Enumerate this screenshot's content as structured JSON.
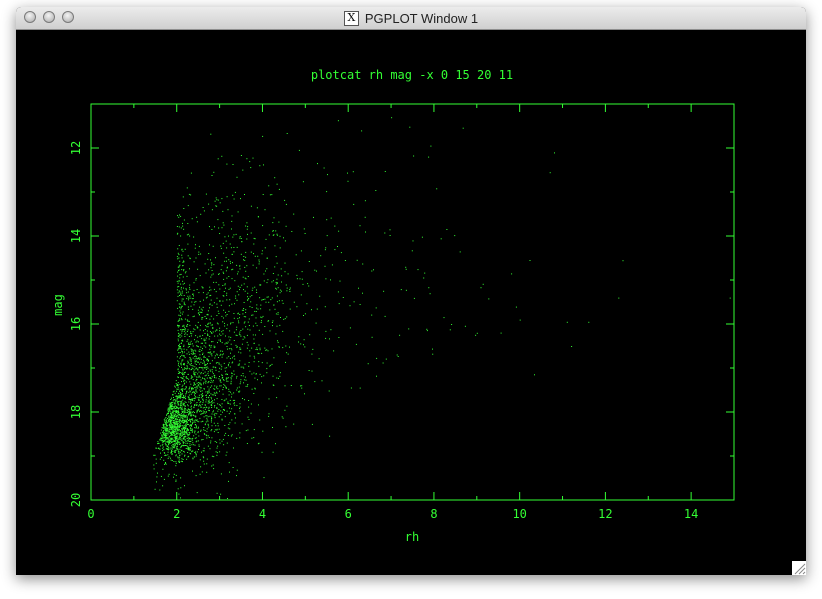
{
  "window": {
    "title": "PGPLOT Window 1"
  },
  "colors": {
    "plot_green": "#33ff33",
    "background": "#000000"
  },
  "chart_data": {
    "type": "scatter",
    "title": "plotcat rh mag -x 0 15 20 11",
    "xlabel": "rh",
    "ylabel": "mag",
    "xlim": [
      0,
      15
    ],
    "ylim": [
      20,
      11
    ],
    "x_ticks": [
      "0",
      "2",
      "4",
      "6",
      "8",
      "10",
      "12",
      "14"
    ],
    "y_ticks": [
      "12",
      "14",
      "16",
      "18",
      "20"
    ],
    "grid": false,
    "point_color": "#33ff33",
    "clusters": [
      {
        "x_mean": 1.9,
        "x_sd": 0.25,
        "y_mean": 18.3,
        "y_sd": 0.35,
        "n": 900
      },
      {
        "x_mean": 2.3,
        "x_sd": 0.55,
        "y_mean": 17.5,
        "y_sd": 0.9,
        "n": 1400
      },
      {
        "x_mean": 1.9,
        "x_sd": 0.15,
        "y_mean": 15.5,
        "y_sd": 1.3,
        "n": 500
      },
      {
        "x_mean": 3.2,
        "x_sd": 1.0,
        "y_mean": 15.6,
        "y_sd": 1.4,
        "n": 900
      },
      {
        "x_mean": 1.2,
        "x_sd": 0.5,
        "y_mean": 18.6,
        "y_sd": 0.6,
        "n": 220
      },
      {
        "x_mean": 5.5,
        "x_sd": 2.0,
        "y_mean": 15.0,
        "y_sd": 1.6,
        "n": 150
      }
    ],
    "outliers": [
      {
        "x": 10.8,
        "y": 12.1
      },
      {
        "x": 10.7,
        "y": 12.55
      },
      {
        "x": 11.1,
        "y": 15.95
      },
      {
        "x": 11.6,
        "y": 15.95
      },
      {
        "x": 12.3,
        "y": 15.4
      },
      {
        "x": 12.4,
        "y": 14.55
      },
      {
        "x": 9.8,
        "y": 14.85
      },
      {
        "x": 8.6,
        "y": 14.35
      },
      {
        "x": 7.5,
        "y": 14.1
      },
      {
        "x": 8.4,
        "y": 16.0
      },
      {
        "x": 9.0,
        "y": 16.2
      },
      {
        "x": 11.2,
        "y": 16.5
      },
      {
        "x": 10.0,
        "y": 15.9
      },
      {
        "x": 7.9,
        "y": 15.3
      },
      {
        "x": 7.0,
        "y": 11.3
      },
      {
        "x": 6.3,
        "y": 11.6
      },
      {
        "x": 14.9,
        "y": 15.4
      },
      {
        "x": 7.4,
        "y": 16.1
      }
    ]
  }
}
